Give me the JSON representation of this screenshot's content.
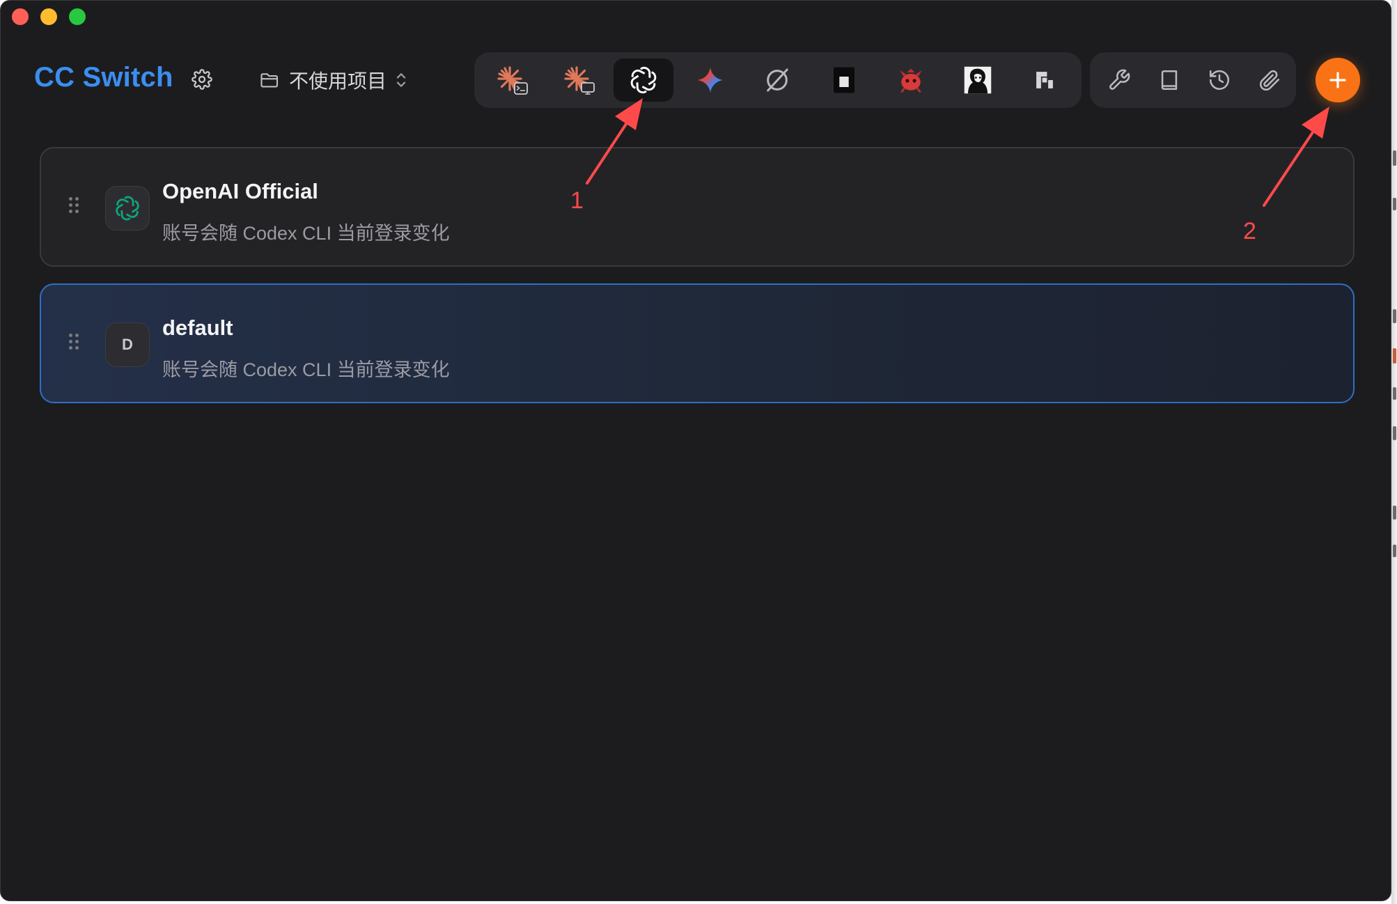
{
  "window": {
    "title": "CC Switch"
  },
  "header": {
    "settings_icon": "gear-icon",
    "project_selector": {
      "label": "不使用项目",
      "icon": "folder-icon",
      "chevron": "chevron-updown-icon"
    }
  },
  "app_toolbar": {
    "items": [
      {
        "name": "claude-code",
        "icon": "claude-terminal-icon",
        "active": false
      },
      {
        "name": "claude-desktop",
        "icon": "claude-desktop-icon",
        "active": false
      },
      {
        "name": "openai-codex",
        "icon": "openai-icon",
        "active": true
      },
      {
        "name": "gemini",
        "icon": "gemini-sparkle-icon",
        "active": false
      },
      {
        "name": "opencode",
        "icon": "slashed-circle-icon",
        "active": false
      },
      {
        "name": "terminal-app",
        "icon": "dark-square-icon",
        "active": false
      },
      {
        "name": "red-bot",
        "icon": "red-creature-icon",
        "active": false
      },
      {
        "name": "portrait-app",
        "icon": "portrait-icon",
        "active": false
      },
      {
        "name": "pixel-app",
        "icon": "pixel-block-icon",
        "active": false
      }
    ]
  },
  "tools_toolbar": {
    "items": [
      {
        "name": "tools",
        "icon": "wrench-icon"
      },
      {
        "name": "prompts",
        "icon": "book-icon"
      },
      {
        "name": "history",
        "icon": "history-icon"
      },
      {
        "name": "attachments",
        "icon": "paperclip-icon"
      }
    ]
  },
  "add_button": {
    "icon": "plus-icon",
    "color": "#f97316"
  },
  "providers": [
    {
      "name": "OpenAI Official",
      "description": "账号会随 Codex CLI 当前登录变化",
      "avatar_icon": "openai-icon",
      "selected": false
    },
    {
      "name": "default",
      "description": "账号会随 Codex CLI 当前登录变化",
      "avatar_letter": "D",
      "selected": true
    }
  ],
  "annotations": [
    {
      "label": "1",
      "points_to": "openai-codex toolbar icon",
      "color": "#ff4a4a"
    },
    {
      "label": "2",
      "points_to": "add button",
      "color": "#ff4a4a"
    }
  ],
  "colors": {
    "background": "#1c1c1e",
    "accent_blue": "#3b8ef0",
    "selected_border": "#2f6fc4",
    "annotation_red": "#ff4a4a"
  }
}
